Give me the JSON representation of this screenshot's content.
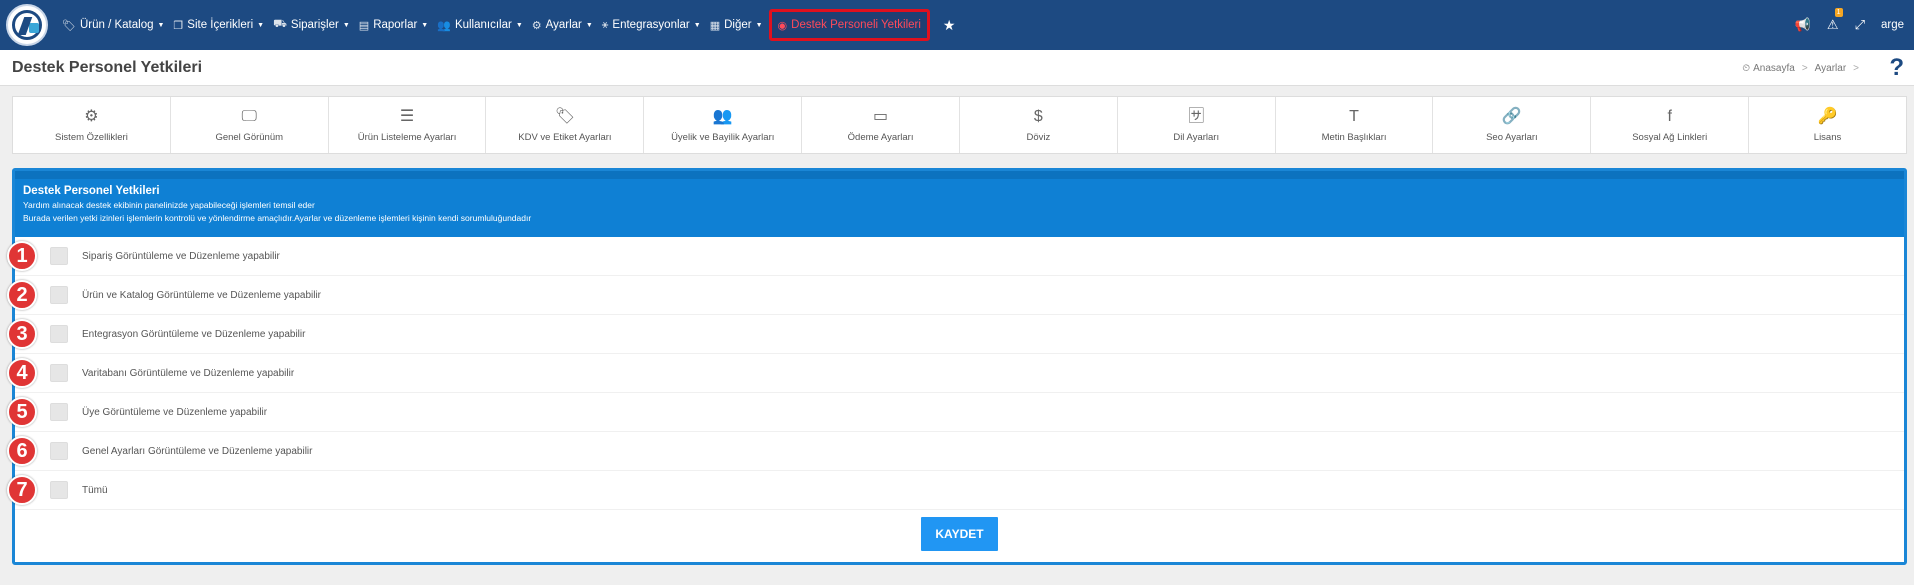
{
  "nav": {
    "items": [
      {
        "label": "Ürün / Katalog",
        "icon": "tags-icon",
        "glyph": "🏷"
      },
      {
        "label": "Site İçerikleri",
        "icon": "copy-icon",
        "glyph": "❐"
      },
      {
        "label": "Siparişler",
        "icon": "truck-icon",
        "glyph": "⛟"
      },
      {
        "label": "Raporlar",
        "icon": "file-icon",
        "glyph": "▤"
      },
      {
        "label": "Kullanıcılar",
        "icon": "users-icon",
        "glyph": "👥"
      },
      {
        "label": "Ayarlar",
        "icon": "cogs-icon",
        "glyph": "⚙"
      },
      {
        "label": "Entegrasyonlar",
        "icon": "sitemap-icon",
        "glyph": "⚹"
      },
      {
        "label": "Diğer",
        "icon": "grid-icon",
        "glyph": "▦"
      }
    ],
    "active": {
      "label": "Destek Personeli Yetkileri",
      "icon": "user-circle-icon",
      "glyph": "◉"
    },
    "user": "arge",
    "alert_count": "1"
  },
  "page": {
    "title": "Destek Personel Yetkileri",
    "breadcrumb": [
      "Anasayfa",
      "Ayarlar"
    ]
  },
  "tabs": [
    {
      "label": "Sistem Özellikleri",
      "icon": "cogs-icon",
      "glyph": "⚙"
    },
    {
      "label": "Genel Görünüm",
      "icon": "desktop-icon",
      "glyph": "🖵"
    },
    {
      "label": "Ürün Listeleme Ayarları",
      "icon": "list-icon",
      "glyph": "☰"
    },
    {
      "label": "KDV ve Etiket Ayarları",
      "icon": "tags-icon",
      "glyph": "🏷"
    },
    {
      "label": "Üyelik ve Bayilik Ayarları",
      "icon": "users-icon",
      "glyph": "👥"
    },
    {
      "label": "Ödeme Ayarları",
      "icon": "credit-card-icon",
      "glyph": "▭"
    },
    {
      "label": "Döviz",
      "icon": "dollar-icon",
      "glyph": "$"
    },
    {
      "label": "Dil Ayarları",
      "icon": "language-icon",
      "glyph": "🈂"
    },
    {
      "label": "Metin Başlıkları",
      "icon": "text-icon",
      "glyph": "T"
    },
    {
      "label": "Seo Ayarları",
      "icon": "link-icon",
      "glyph": "🔗"
    },
    {
      "label": "Sosyal Ağ Linkleri",
      "icon": "facebook-icon",
      "glyph": "f"
    },
    {
      "label": "Lisans",
      "icon": "key-icon",
      "glyph": "🔑"
    }
  ],
  "panel": {
    "title": "Destek Personel Yetkileri",
    "desc1": "Yardım alınacak destek ekibinin panelinizde yapabileceği işlemleri temsil eder",
    "desc2": "Burada verilen yetki izinleri işlemlerin kontrolü ve yönlendirme amaçlıdır.Ayarlar ve düzenleme işlemleri kişinin kendi sorumluluğundadır",
    "permissions": [
      {
        "num": "1",
        "label": "Sipariş Görüntüleme ve Düzenleme yapabilir"
      },
      {
        "num": "2",
        "label": "Ürün ve Katalog Görüntüleme ve Düzenleme yapabilir"
      },
      {
        "num": "3",
        "label": "Entegrasyon Görüntüleme ve Düzenleme yapabilir"
      },
      {
        "num": "4",
        "label": "Varitabanı Görüntüleme ve Düzenleme yapabilir"
      },
      {
        "num": "5",
        "label": "Üye Görüntüleme ve Düzenleme yapabilir"
      },
      {
        "num": "6",
        "label": "Genel Ayarları Görüntüleme ve Düzenleme yapabilir"
      },
      {
        "num": "7",
        "label": "Tümü"
      }
    ],
    "save_label": "KAYDET"
  }
}
